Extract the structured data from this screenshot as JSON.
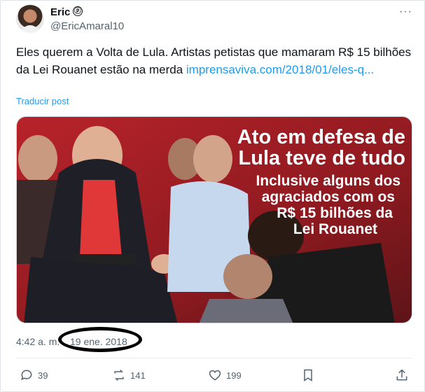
{
  "author": {
    "name": "Eric",
    "badge": "ⓟ",
    "handle": "@EricAmaral10"
  },
  "menu_icon": "more-dots-icon",
  "tweet": {
    "text": "Eles querem a Volta de Lula. Artistas petistas que mamaram R$ 15 bilhões da Lei Rouanet estão na merda ",
    "link": "imprensaviva.com/2018/01/eles-q...",
    "translate": "Traducir post"
  },
  "media": {
    "headline_line1": "Ato em defesa de",
    "headline_line2": "Lula teve de tudo",
    "sub_line1": "Inclusive alguns dos",
    "sub_line2": "agraciados com os",
    "sub_line3": "R$ 15 bilhões da",
    "sub_line4": "Lei Rouanet"
  },
  "meta": {
    "time": "4:42 a. m.",
    "dot": "·",
    "date": "19 ene. 2018"
  },
  "actions": {
    "replies": "39",
    "reposts": "141",
    "likes": "199"
  },
  "colors": {
    "link": "#1d9bf0",
    "muted": "#536471",
    "text": "#0f1419"
  }
}
